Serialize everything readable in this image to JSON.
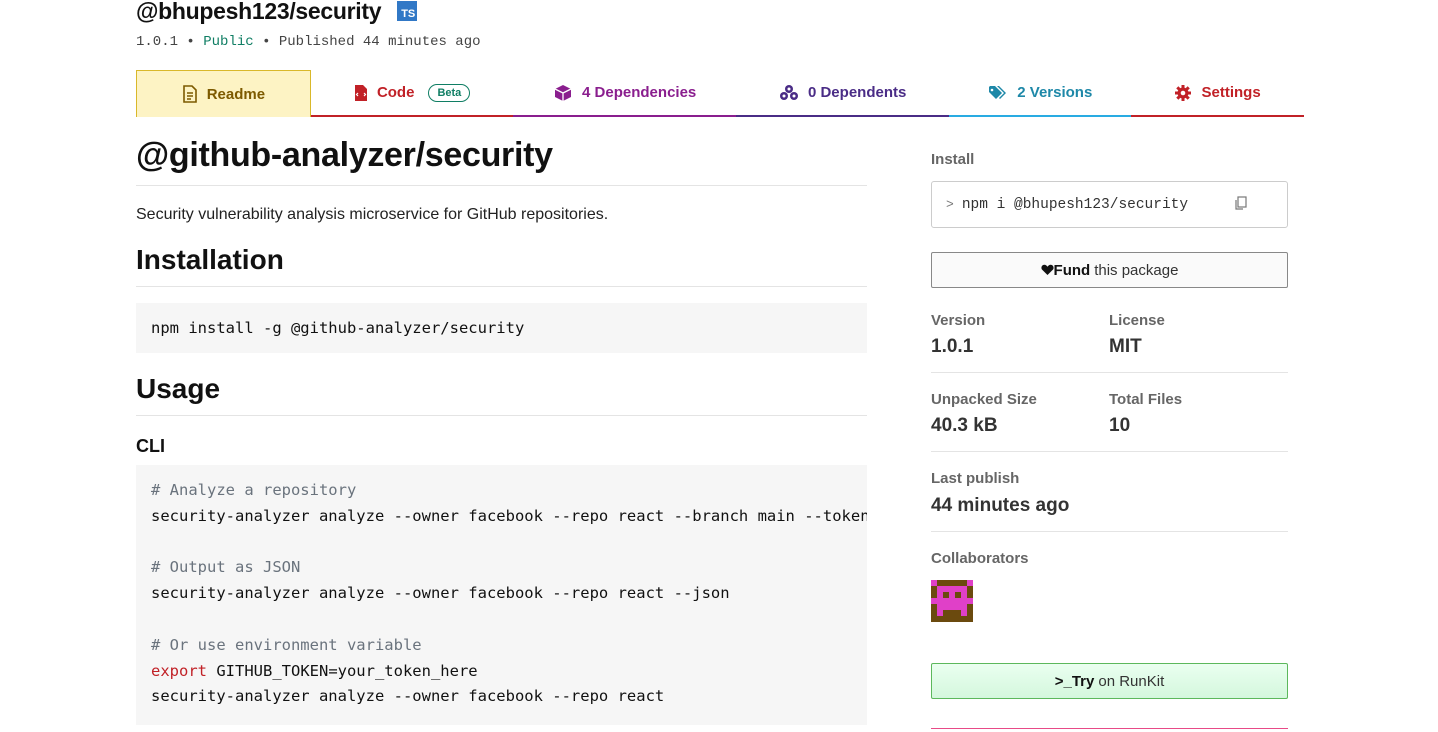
{
  "header": {
    "package_name": "@bhupesh123/security",
    "ts_badge": "TS",
    "version": "1.0.1",
    "sep1": "•",
    "visibility": "Public",
    "sep2": "•",
    "published": "Published 44 minutes ago"
  },
  "tabs": {
    "readme": "Readme",
    "code": "Code",
    "code_badge": "Beta",
    "dependencies": "4 Dependencies",
    "dependents": "0 Dependents",
    "versions": "2 Versions",
    "settings": "Settings"
  },
  "colors": {
    "readme_tab_bg": "#fdf3c4",
    "code": "#c12127",
    "deps": "#8a1e8e",
    "dependents": "#4a2c86",
    "versions": "#29abe2",
    "settings": "#c12127",
    "public": "#107e64"
  },
  "readme": {
    "title": "@github-analyzer/security",
    "description": "Security vulnerability analysis microservice for GitHub repositories.",
    "installation_heading": "Installation",
    "install_cmd": "npm install -g @github-analyzer/security",
    "usage_heading": "Usage",
    "cli_heading": "CLI",
    "cli_lines": {
      "c1": "# Analyze a repository",
      "l1": "security-analyzer analyze --owner facebook --repo react --branch main --token your_token",
      "c2": "# Output as JSON",
      "l2": "security-analyzer analyze --owner facebook --repo react --json",
      "c3": "# Or use environment variable",
      "kw": "export",
      "l3": " GITHUB_TOKEN=your_token_here",
      "l4": "security-analyzer analyze --owner facebook --repo react"
    }
  },
  "sidebar": {
    "install_label": "Install",
    "install_prompt": ">",
    "install_cmd": "npm i @bhupesh123/security",
    "fund_bold": "Fund",
    "fund_rest": "this package",
    "version_label": "Version",
    "version_value": "1.0.1",
    "license_label": "License",
    "license_value": "MIT",
    "unpacked_label": "Unpacked Size",
    "unpacked_value": "40.3 kB",
    "files_label": "Total Files",
    "files_value": "10",
    "last_publish_label": "Last publish",
    "last_publish_value": "44 minutes ago",
    "collaborators_label": "Collaborators",
    "runkit_bold": ">_Try",
    "runkit_rest": "on RunKit"
  }
}
